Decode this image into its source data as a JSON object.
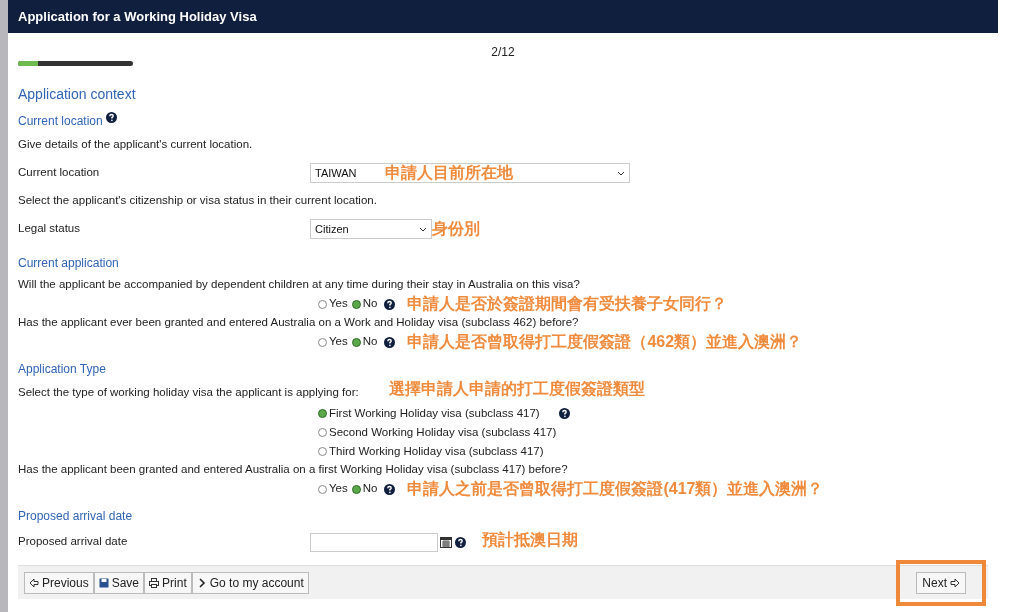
{
  "window": {
    "title": "Application for a Working Holiday Visa"
  },
  "progress": {
    "step": "2/12",
    "level": 0.17
  },
  "page_title": "Application context",
  "rows": [
    {
      "kind": "heading",
      "text": "Current location",
      "help": true
    },
    {
      "kind": "text",
      "text": "Give details of the applicant's current location."
    },
    {
      "kind": "select",
      "label": "Current location",
      "value": "TAIWAN",
      "note": "申請人目前所在地"
    },
    {
      "kind": "text",
      "text": "Select the applicant's citizenship or visa status in their current location."
    },
    {
      "kind": "select",
      "label": "Legal status",
      "value": "Citizen",
      "note": "身份別"
    },
    {
      "kind": "heading",
      "text": "Current application"
    },
    {
      "kind": "radio",
      "question": "Will the applicant be accompanied by dependent children at any time during their stay in Australia on this visa?",
      "options": [
        {
          "label": "Yes",
          "selected": false
        },
        {
          "label": "No",
          "selected": true
        }
      ],
      "note": "申請人是否於簽證期間會有受扶養子女同行？"
    },
    {
      "kind": "radio",
      "question": "Has the applicant ever been granted and entered Australia on a Work and Holiday visa (subclass 462) before?",
      "options": [
        {
          "label": "Yes",
          "selected": false
        },
        {
          "label": "No",
          "selected": true
        }
      ],
      "note": "申請人是否曾取得打工度假簽證（462類）並進入澳洲？"
    },
    {
      "kind": "heading",
      "text": "Application Type"
    },
    {
      "kind": "choice",
      "question": "Select the type of working holiday visa the applicant is applying for:",
      "note": "選擇申請人申請的打工度假簽證類型",
      "options": [
        {
          "label": "First Working Holiday visa (subclass 417)",
          "selected": true
        },
        {
          "label": "Second Working Holiday visa (subclass 417)",
          "selected": false
        },
        {
          "label": "Third Working Holiday visa (subclass 417)",
          "selected": false
        }
      ]
    },
    {
      "kind": "radio",
      "question": "Has the applicant been granted and entered Australia on a first Working Holiday visa (subclass 417) before?",
      "options": [
        {
          "label": "Yes",
          "selected": false
        },
        {
          "label": "No",
          "selected": true
        }
      ],
      "note": "申請人之前是否曾取得打工度假簽證(417類）並進入澳洲？"
    },
    {
      "kind": "heading",
      "text": "Proposed arrival date"
    },
    {
      "kind": "date",
      "label": "Proposed arrival date",
      "note": "預計抵澳日期"
    }
  ],
  "footer": {
    "buttons": [
      {
        "kind": "previous",
        "label": "Previous"
      },
      {
        "kind": "save",
        "label": "Save"
      },
      {
        "kind": "print",
        "label": "Print"
      },
      {
        "kind": "account",
        "label": "Go to my account"
      }
    ],
    "next": {
      "label": "Next",
      "highlighted": true
    }
  }
}
